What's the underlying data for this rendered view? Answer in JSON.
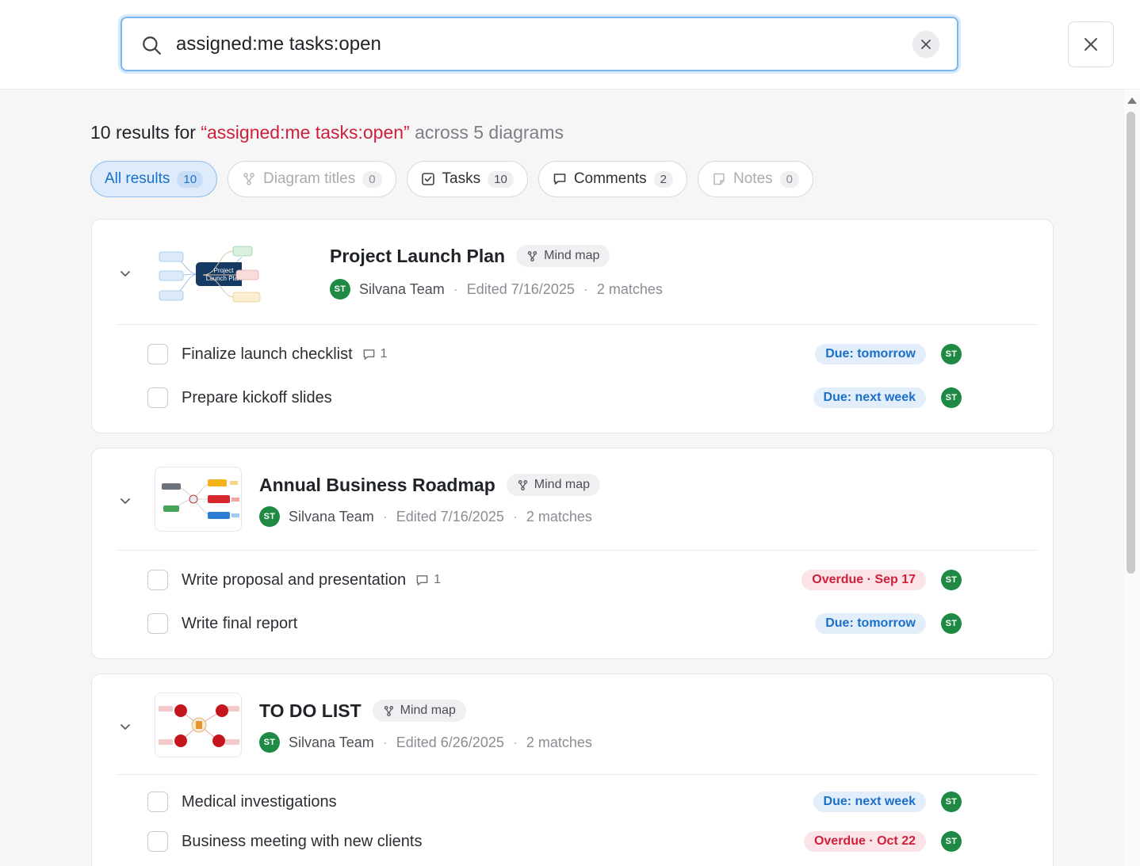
{
  "search": {
    "value": "assigned:me tasks:open",
    "clear_label": "✕",
    "close_label": "✕"
  },
  "summary": {
    "count_text": "10 results for ",
    "query_text": "“assigned:me tasks:open”",
    "rest_text": " across 5 diagrams"
  },
  "filters": [
    {
      "label": "All results",
      "count": "10",
      "icon": "",
      "state": "active"
    },
    {
      "label": "Diagram titles",
      "count": "0",
      "icon": "diagram-icon",
      "state": "disabled"
    },
    {
      "label": "Tasks",
      "count": "10",
      "icon": "checkbox-icon",
      "state": "normal"
    },
    {
      "label": "Comments",
      "count": "2",
      "icon": "comment-icon",
      "state": "normal"
    },
    {
      "label": "Notes",
      "count": "0",
      "icon": "note-icon",
      "state": "disabled"
    }
  ],
  "cards": [
    {
      "title": "Project Launch Plan",
      "type": "Mind map",
      "owner_initials": "ST",
      "owner": "Silvana Team",
      "edited": "Edited 7/16/2025",
      "matches": "2 matches",
      "thumb_label_1": "Project",
      "thumb_label_2": "Launch Plan",
      "tasks": [
        {
          "label": "Finalize launch checklist",
          "comments": "1",
          "due": "Due: tomorrow",
          "due_state": "normal",
          "assignee": "ST"
        },
        {
          "label": "Prepare kickoff slides",
          "comments": "",
          "due": "Due: next week",
          "due_state": "normal",
          "assignee": "ST"
        }
      ]
    },
    {
      "title": "Annual Business Roadmap",
      "type": "Mind map",
      "owner_initials": "ST",
      "owner": "Silvana Team",
      "edited": "Edited 7/16/2025",
      "matches": "2 matches",
      "tasks": [
        {
          "label": "Write proposal and presentation",
          "comments": "1",
          "due": "Overdue · Sep 17",
          "due_state": "overdue",
          "assignee": "ST"
        },
        {
          "label": "Write final report",
          "comments": "",
          "due": "Due: tomorrow",
          "due_state": "normal",
          "assignee": "ST"
        }
      ]
    },
    {
      "title": "TO DO LIST",
      "type": "Mind map",
      "owner_initials": "ST",
      "owner": "Silvana Team",
      "edited": "Edited 6/26/2025",
      "matches": "2 matches",
      "tasks": [
        {
          "label": "Medical investigations",
          "comments": "",
          "due": "Due: next week",
          "due_state": "normal",
          "assignee": "ST"
        },
        {
          "label": "Business meeting with new clients",
          "comments": "",
          "due": "Overdue · Oct 22",
          "due_state": "overdue",
          "assignee": "ST"
        }
      ]
    }
  ],
  "colors": {
    "accent": "#1a6fc9",
    "overdue": "#cf1f3a",
    "avatar": "#1e8a43"
  }
}
